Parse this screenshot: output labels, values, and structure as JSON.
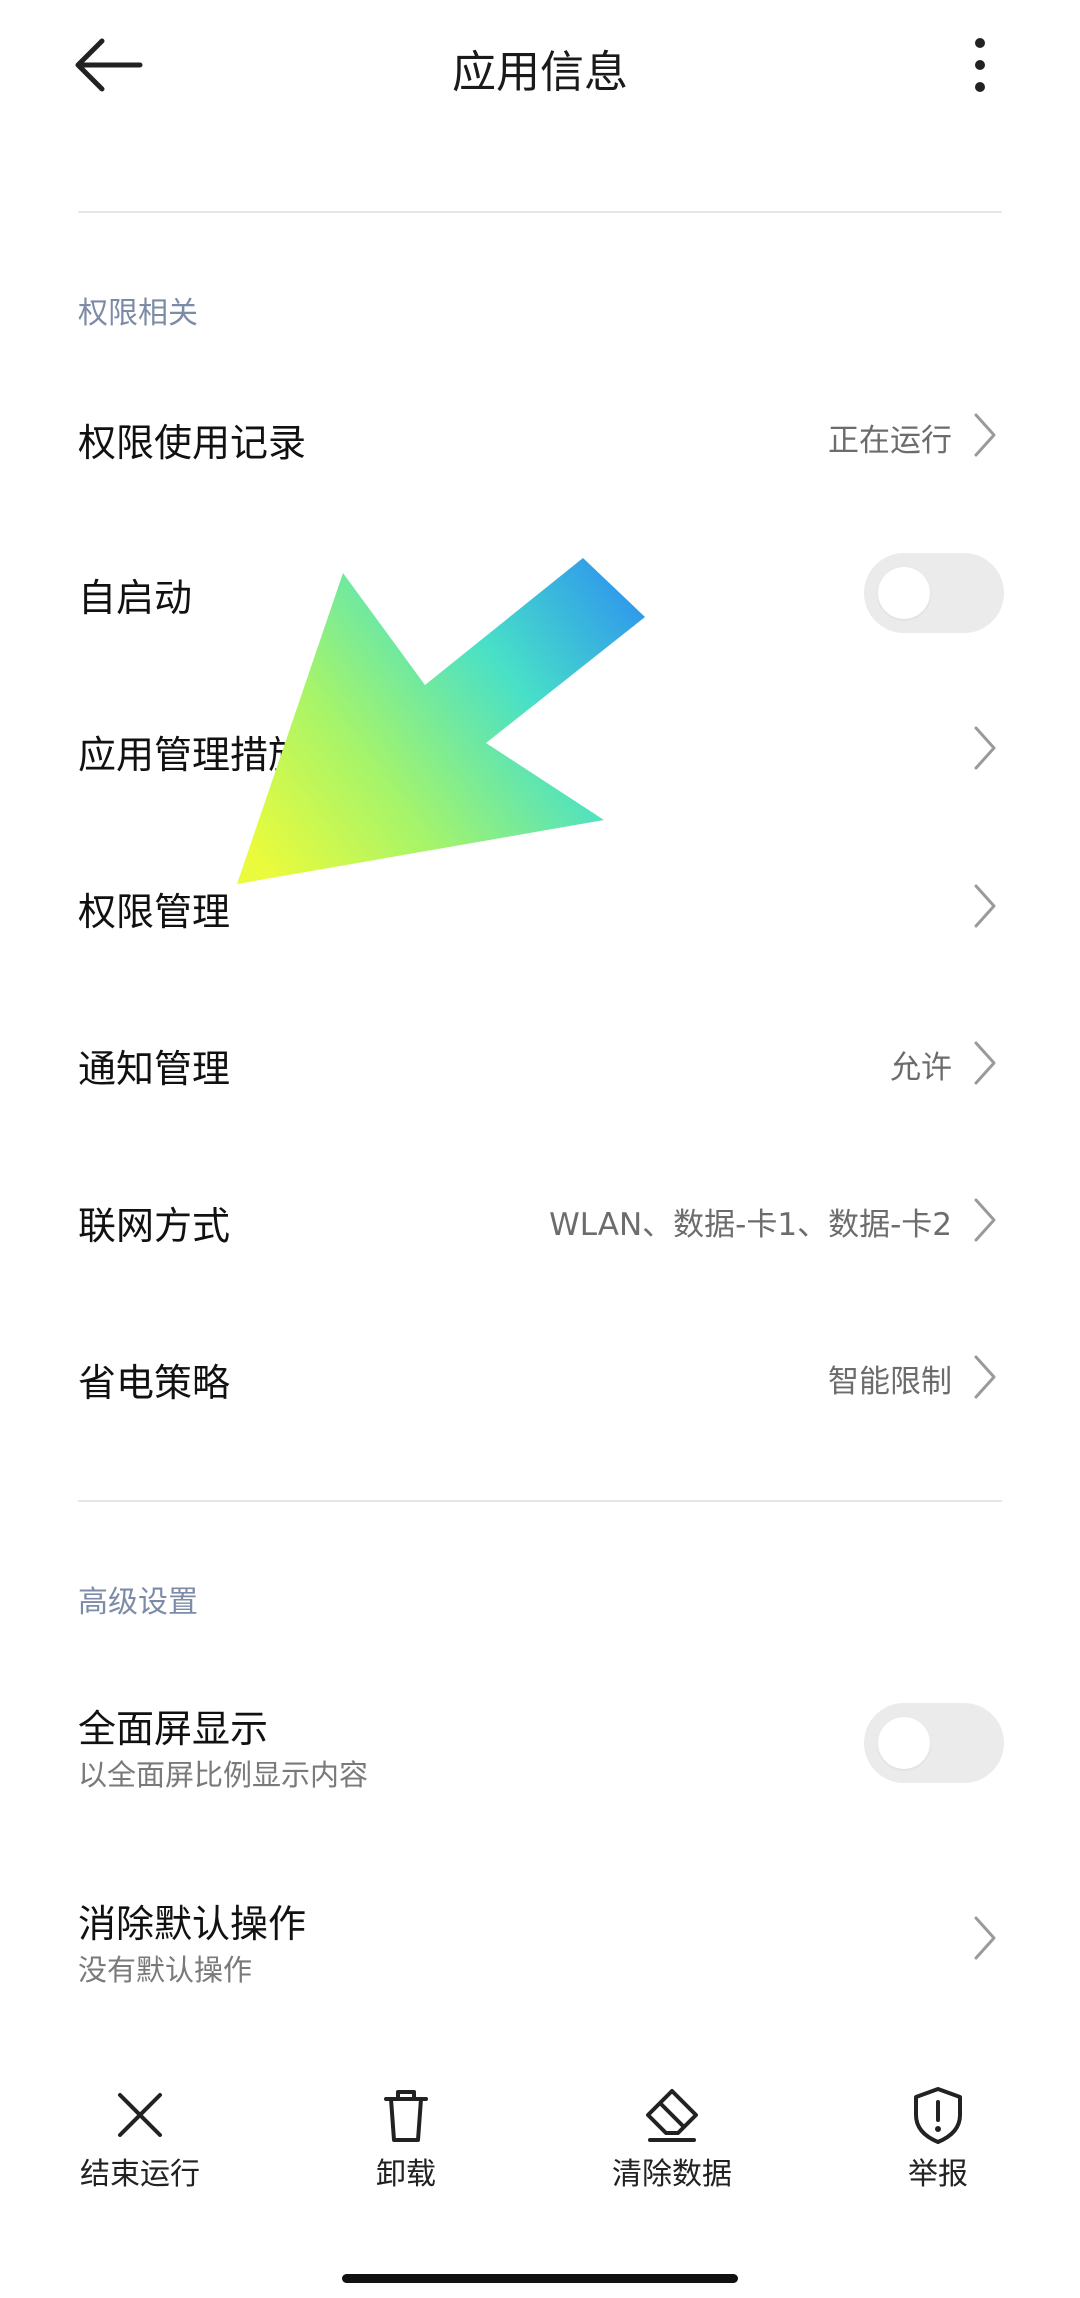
{
  "header": {
    "title": "应用信息",
    "back_icon": "arrow-left-icon",
    "more_icon": "more-vertical-icon"
  },
  "sections": {
    "permissions": {
      "title": "权限相关"
    },
    "advanced": {
      "title": "高级设置"
    }
  },
  "rows": {
    "permission_usage": {
      "label": "权限使用记录",
      "value": "正在运行"
    },
    "autostart": {
      "label": "自启动",
      "enabled": false
    },
    "app_management": {
      "label": "应用管理措施"
    },
    "permission_management": {
      "label": "权限管理"
    },
    "notification_management": {
      "label": "通知管理",
      "value": "允许"
    },
    "network": {
      "label": "联网方式",
      "value": "WLAN、数据-卡1、数据-卡2"
    },
    "power_saving": {
      "label": "省电策略",
      "value": "智能限制"
    },
    "fullscreen": {
      "label": "全面屏显示",
      "sub": "以全面屏比例显示内容",
      "enabled": false
    },
    "clear_defaults": {
      "label": "消除默认操作",
      "sub": "没有默认操作"
    }
  },
  "bottom_bar": {
    "force_stop": {
      "label": "结束运行",
      "icon": "close-icon"
    },
    "uninstall": {
      "label": "卸载",
      "icon": "trash-icon"
    },
    "clear_data": {
      "label": "清除数据",
      "icon": "eraser-icon"
    },
    "report": {
      "label": "举报",
      "icon": "shield-alert-icon"
    }
  },
  "colors": {
    "accent_arrow_start": "#2c8ff0",
    "accent_arrow_mid": "#48e0c8",
    "accent_arrow_end": "#e9fb3c",
    "section_header": "#7d8ca6",
    "toggle_off": "#ebebeb"
  }
}
